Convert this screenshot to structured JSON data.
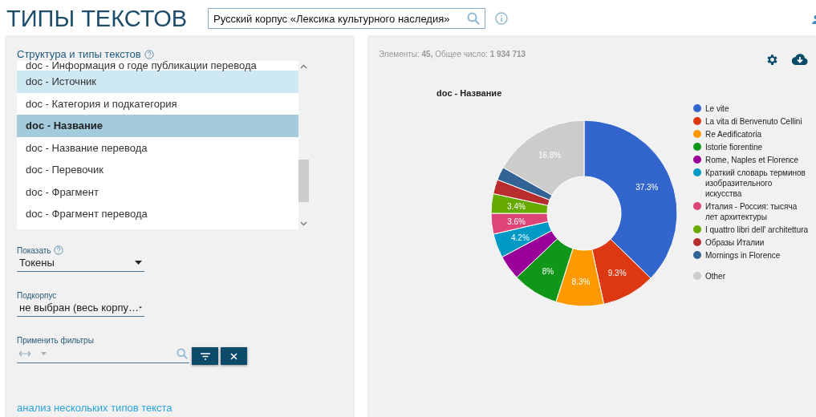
{
  "header": {
    "title": "ТИПЫ ТЕКСТОВ",
    "corpus_field": {
      "value": "Русский корпус «Лексика культурного наследия»"
    }
  },
  "structure": {
    "label": "Структура и типы текстов",
    "items": [
      {
        "label": "doc - Информация о годе публикации перевода",
        "selected": false,
        "highlighted": false
      },
      {
        "label": "doc - Источник",
        "selected": false,
        "highlighted": true
      },
      {
        "label": "doc - Категория и подкатегория",
        "selected": false,
        "highlighted": false
      },
      {
        "label": "doc - Название",
        "selected": true,
        "highlighted": false
      },
      {
        "label": "doc - Название перевода",
        "selected": false,
        "highlighted": false
      },
      {
        "label": "doc - Перевочик",
        "selected": false,
        "highlighted": false
      },
      {
        "label": "doc - Фрагмент",
        "selected": false,
        "highlighted": false
      },
      {
        "label": "doc - Фрагмент перевода",
        "selected": false,
        "highlighted": false
      }
    ]
  },
  "show": {
    "label": "Показать",
    "value": "Токены"
  },
  "subcorpus": {
    "label": "Подкорпус",
    "value": "не выбран (весь корпу…"
  },
  "filters": {
    "label": "Применить фильтры"
  },
  "multi_link": "анализ нескольких типов текста",
  "stats": {
    "elements_label": "Элементы:",
    "elements": "45,",
    "total_label": "Общее число:",
    "total": "1 934 713"
  },
  "chart_data": {
    "type": "donut",
    "title": "doc - Название",
    "categories": [
      "Le vite",
      "La vita di Benvenuto Cellini",
      "Re Aedificatoria",
      "Istorie fiorentine",
      "Rome, Naples et Florence",
      "Краткий словарь терминов изобразительного искусства",
      "Италия - Россия: тысяча лет архитектуры",
      "I quattro libri dell' architettura",
      "Образы Италии",
      "Mornings in Florence",
      "Other"
    ],
    "legend": "right",
    "series": [
      {
        "colors": [
          "#3366cc",
          "#dc3912",
          "#ff9900",
          "#109618",
          "#990099",
          "#0099c6",
          "#dd4477",
          "#66aa00",
          "#b82e2e",
          "#316395",
          "#cccccc"
        ],
        "values": [
          37.3,
          9.3,
          8.3,
          8,
          4.3,
          4.2,
          3.6,
          3.4,
          2.5,
          2.3,
          16.8
        ]
      }
    ],
    "value_labels": [
      "37.3%",
      "9.3%",
      "8.3%",
      "8%",
      null,
      "4.2%",
      "3.6%",
      "3.4%",
      null,
      null,
      "16.8%"
    ]
  }
}
